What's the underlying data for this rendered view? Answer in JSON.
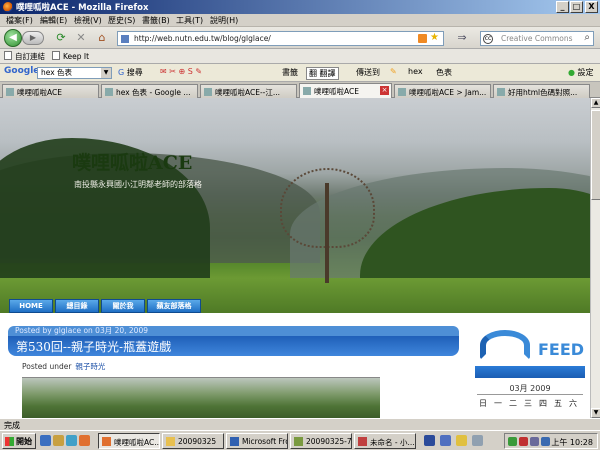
{
  "window": {
    "title": "噗哩呱啦ACE - Mozilla Firefox",
    "buttons": {
      "minimize": "_",
      "maximize": "□",
      "close": "X"
    }
  },
  "menu": [
    "檔案(F)",
    "編輯(E)",
    "檢視(V)",
    "歷史(S)",
    "書籤(B)",
    "工具(T)",
    "說明(H)"
  ],
  "nav": {
    "back_glyph": "◀",
    "forward_glyph": "▶",
    "url": "http://web.nutn.edu.tw/blog/glglace/",
    "search_placeholder": "Creative Commons",
    "search_engine_glyph": "cc"
  },
  "bookmarks": [
    "自訂連結",
    "Keep It"
  ],
  "google_toolbar": {
    "logo": "Google",
    "query": "hex 色表",
    "items": [
      "搜尋",
      "書籤",
      "翻譯",
      "傳送到",
      "hex",
      "色表",
      "設定"
    ]
  },
  "tabs": [
    {
      "label": "噗哩呱啦ACE",
      "active": false
    },
    {
      "label": "hex 色表 - Google ...",
      "active": false
    },
    {
      "label": "噗哩呱啦ACE--江...",
      "active": false
    },
    {
      "label": "噗哩呱啦ACE",
      "active": true
    },
    {
      "label": "噗哩呱啦ACE > Jam...",
      "active": false
    },
    {
      "label": "好用html色碼對照...",
      "active": false
    }
  ],
  "blog": {
    "title": "噗哩呱啦ACE",
    "description": "南投縣永興國小江明鄰老師的部落格",
    "nav": [
      "HOME",
      "總目錄",
      "關於我",
      "蘋友部落格"
    ]
  },
  "post": {
    "meta": "Posted by glglace on 03月 20, 2009",
    "title": "第530回--親子時光-瓶蓋遊戲",
    "posted_under_label": "Posted under",
    "category": "親子時光"
  },
  "sidebar": {
    "feed_label": "FEED",
    "calendar": {
      "month": "03月 2009",
      "weekdays": [
        "日",
        "一",
        "二",
        "三",
        "四",
        "五",
        "六"
      ]
    }
  },
  "status": {
    "text": "完成"
  },
  "taskbar": {
    "start": "開始",
    "windows": [
      {
        "label": "噗哩呱啦AC...",
        "active": true
      },
      {
        "label": "20090325",
        "active": false
      },
      {
        "label": "Microsoft Fro...",
        "active": false
      },
      {
        "label": "20090325-7.j...",
        "active": false
      },
      {
        "label": "未命名 - 小...",
        "active": false
      }
    ],
    "clock": "上午 10:28"
  }
}
